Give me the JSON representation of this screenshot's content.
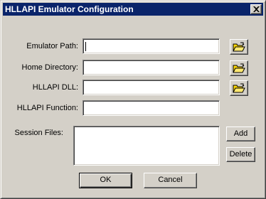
{
  "window": {
    "title": "HLLAPI Emulator Configuration",
    "close_glyph": "✕"
  },
  "form": {
    "emulator_path": {
      "label": "Emulator Path:",
      "value": ""
    },
    "home_directory": {
      "label": "Home Directory:",
      "value": ""
    },
    "hllapi_dll": {
      "label": "HLLAPI DLL:",
      "value": ""
    },
    "hllapi_function": {
      "label": "HLLAPI Function:",
      "value": ""
    },
    "session_files": {
      "label": "Session Files:",
      "value": ""
    }
  },
  "buttons": {
    "add": "Add",
    "delete": "Delete",
    "ok": "OK",
    "cancel": "Cancel"
  },
  "icons": {
    "browse": "open-folder-icon",
    "close": "close-icon"
  },
  "colors": {
    "titlebar": "#0a246a",
    "face": "#d4d0c8",
    "folder": "#ffd800"
  }
}
